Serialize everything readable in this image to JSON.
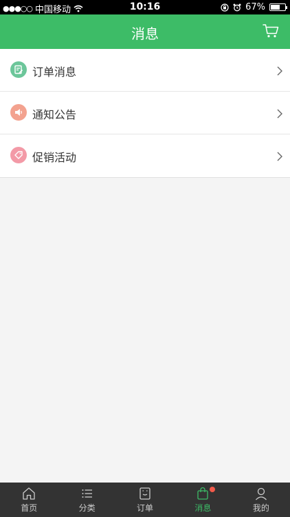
{
  "status_bar": {
    "signal_dots": "●●●○○",
    "carrier": "中国移动",
    "time": "10:16",
    "battery": "67%",
    "battery_level": 0.67
  },
  "header": {
    "title": "消息",
    "cart_icon": "shopping-cart-icon"
  },
  "colors": {
    "primary": "#3dbc67",
    "order_icon": "#6cc69a",
    "notice_icon": "#f3a28f",
    "promo_icon": "#f39aa7",
    "badge": "#f25a4a"
  },
  "menu": [
    {
      "label": "订单消息",
      "icon": "order-message-icon"
    },
    {
      "label": "通知公告",
      "icon": "announcement-icon"
    },
    {
      "label": "促销活动",
      "icon": "promotion-tag-icon"
    }
  ],
  "tabs": [
    {
      "label": "首页",
      "icon": "home-icon"
    },
    {
      "label": "分类",
      "icon": "category-list-icon"
    },
    {
      "label": "订单",
      "icon": "order-icon"
    },
    {
      "label": "消息",
      "icon": "message-bag-icon",
      "active": true,
      "badge": true
    },
    {
      "label": "我的",
      "icon": "profile-icon"
    }
  ]
}
